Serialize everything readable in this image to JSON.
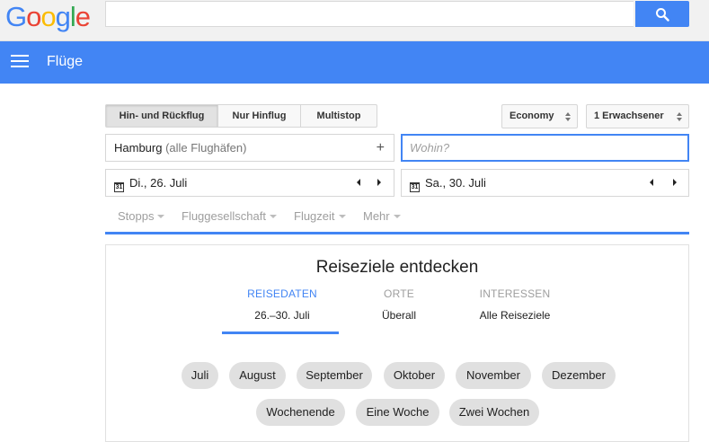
{
  "logo": {
    "letters": [
      "G",
      "o",
      "o",
      "g",
      "l",
      "e"
    ],
    "colors": [
      "#4285f4",
      "#ea4335",
      "#fbbc05",
      "#4285f4",
      "#34a853",
      "#ea4335"
    ]
  },
  "search": {
    "value": "",
    "placeholder": ""
  },
  "appbar": {
    "title": "Flüge",
    "color": "#4285f4"
  },
  "trip_types": [
    "Hin- und Rückflug",
    "Nur Hinflug",
    "Multistop"
  ],
  "cabin": {
    "selected": "Economy"
  },
  "passengers": {
    "selected": "1 Erwachsener"
  },
  "origin": {
    "city": "Hamburg",
    "qualifier": "(alle Flughäfen)"
  },
  "destination": {
    "placeholder": "Wohin?"
  },
  "dates": {
    "calendar_glyph": "31",
    "depart": "Di., 26. Juli",
    "return": "Sa., 30. Juli"
  },
  "filters": [
    "Stopps",
    "Fluggesellschaft",
    "Flugzeit",
    "Mehr"
  ],
  "explore": {
    "title": "Reiseziele entdecken",
    "tabs": [
      {
        "heading": "REISEDATEN",
        "value": "26.–30. Juli"
      },
      {
        "heading": "ORTE",
        "value": "Überall"
      },
      {
        "heading": "INTERESSEN",
        "value": "Alle Reiseziele"
      }
    ],
    "chips_row1": [
      "Juli",
      "August",
      "September",
      "Oktober",
      "November",
      "Dezember"
    ],
    "chips_row2": [
      "Wochenende",
      "Eine Woche",
      "Zwei Wochen"
    ]
  }
}
